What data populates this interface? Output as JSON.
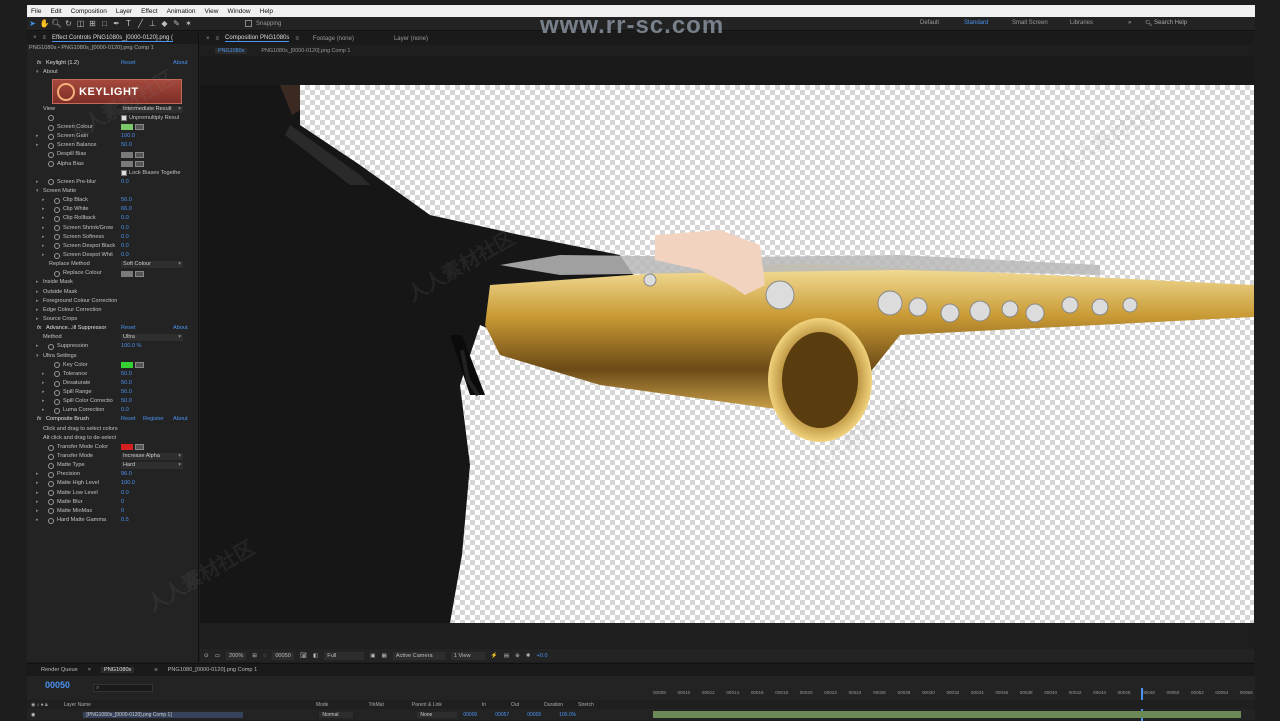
{
  "watermark": "www.rr-sc.com",
  "watermark_cn": "人人素材社区",
  "menu": [
    "File",
    "Edit",
    "Composition",
    "Layer",
    "Effect",
    "Animation",
    "View",
    "Window",
    "Help"
  ],
  "toolbar": {
    "snapping": "Snapping",
    "workspaces": [
      "Default",
      "Standard",
      "Small Screen",
      "Libraries"
    ],
    "active_workspace": "Standard",
    "search_placeholder": "Search Help"
  },
  "effect_controls": {
    "tab_title": "Effect Controls PNG1080s_[0000-0120].png (",
    "breadcrumb": "PNG1080s • PNG1080s_[0000-0120].png Comp 1",
    "logo_text": "KEYLIGHT",
    "rows": [
      {
        "level": 0,
        "fx": true,
        "label": "Keylight (1.2)",
        "link1": "Reset",
        "link2": "About"
      },
      {
        "level": 1,
        "twirl": "open",
        "label": "About"
      },
      {
        "level": 0,
        "label": ""
      },
      {
        "level": 0,
        "label": ""
      },
      {
        "level": 0,
        "label": ""
      },
      {
        "level": 1,
        "label": "View",
        "dropdown": "Intermediate Result"
      },
      {
        "level": 1,
        "sw": true,
        "label": "",
        "checkbox": "Unpremultiply Resul"
      },
      {
        "level": 1,
        "sw": true,
        "label": "Screen Colour",
        "color": "#79c86a",
        "eyed": true
      },
      {
        "level": 1,
        "twirl": "closed",
        "sw": true,
        "label": "Screen Gain",
        "value": "100.0"
      },
      {
        "level": 1,
        "twirl": "closed",
        "sw": true,
        "label": "Screen Balance",
        "value": "50.0"
      },
      {
        "level": 1,
        "sw": true,
        "label": "Despill Bias",
        "color": "#7a7a7a",
        "eyed": true
      },
      {
        "level": 1,
        "sw": true,
        "label": "Alpha Bias",
        "color": "#7a7a7a",
        "eyed": true
      },
      {
        "level": 1,
        "label": "",
        "checkbox": "Lock Biases Togethe"
      },
      {
        "level": 1,
        "twirl": "closed",
        "sw": true,
        "label": "Screen Pre-blur",
        "value": "0.0"
      },
      {
        "level": 1,
        "twirl": "open",
        "label": "Screen Matte"
      },
      {
        "level": 2,
        "twirl": "closed",
        "sw": true,
        "label": "Clip Black",
        "value": "56.0"
      },
      {
        "level": 2,
        "twirl": "closed",
        "sw": true,
        "label": "Clip White",
        "value": "66.0"
      },
      {
        "level": 2,
        "twirl": "closed",
        "sw": true,
        "label": "Clip Rollback",
        "value": "0.0"
      },
      {
        "level": 2,
        "twirl": "closed",
        "sw": true,
        "label": "Screen Shrink/Grow",
        "value": "0.0"
      },
      {
        "level": 2,
        "twirl": "closed",
        "sw": true,
        "label": "Screen Softness",
        "value": "0.0"
      },
      {
        "level": 2,
        "twirl": "closed",
        "sw": true,
        "label": "Screen Despot Black",
        "value": "0.0"
      },
      {
        "level": 2,
        "twirl": "closed",
        "sw": true,
        "label": "Screen Despot Whit",
        "value": "0.0"
      },
      {
        "level": 2,
        "label": "Replace Method",
        "dropdown": "Soft Colour"
      },
      {
        "level": 2,
        "sw": true,
        "label": "Replace Colour",
        "color": "#7a7a7a",
        "eyed": true
      },
      {
        "level": 1,
        "twirl": "closed",
        "label": "Inside Mask"
      },
      {
        "level": 1,
        "twirl": "closed",
        "label": "Outside Mask"
      },
      {
        "level": 1,
        "twirl": "closed",
        "label": "Foreground Colour Correction"
      },
      {
        "level": 1,
        "twirl": "closed",
        "label": "Edge Colour Correction"
      },
      {
        "level": 1,
        "twirl": "closed",
        "label": "Source Crops"
      },
      {
        "level": 0,
        "fx": true,
        "label": "Advance...ill Suppressor",
        "link1": "Reset",
        "link2": "About"
      },
      {
        "level": 1,
        "label": "Method",
        "dropdown": "Ultra"
      },
      {
        "level": 1,
        "twirl": "closed",
        "sw": true,
        "label": "Suppression",
        "value": "100.0 %"
      },
      {
        "level": 1,
        "twirl": "open",
        "label": "Ultra Settings"
      },
      {
        "level": 2,
        "sw": true,
        "label": "Key Color",
        "color": "#35d233",
        "eyed": true
      },
      {
        "level": 2,
        "twirl": "closed",
        "sw": true,
        "label": "Tolerance",
        "value": "50.0"
      },
      {
        "level": 2,
        "twirl": "closed",
        "sw": true,
        "label": "Desaturate",
        "value": "50.0"
      },
      {
        "level": 2,
        "twirl": "closed",
        "sw": true,
        "label": "Spill Range",
        "value": "50.0"
      },
      {
        "level": 2,
        "twirl": "closed",
        "sw": true,
        "label": "Spill Color Correctio",
        "value": "50.0"
      },
      {
        "level": 2,
        "twirl": "closed",
        "sw": true,
        "label": "Luma Correction",
        "value": "0.0"
      },
      {
        "level": 0,
        "fx": true,
        "label": "Composite Brush",
        "link1": "Reset",
        "link0": "Register",
        "link2": "About"
      },
      {
        "level": 1,
        "label": "Click and drag to select colors"
      },
      {
        "level": 1,
        "label": "Alt click and drag to de-select"
      },
      {
        "level": 1,
        "sw": true,
        "label": "Transfer Mode Color",
        "color": "#d42020",
        "eyed": true
      },
      {
        "level": 1,
        "sw": true,
        "label": "Transfer Mode",
        "dropdown": "Increase Alpha"
      },
      {
        "level": 1,
        "sw": true,
        "label": "Matte Type",
        "dropdown": "Hard"
      },
      {
        "level": 1,
        "twirl": "closed",
        "sw": true,
        "label": "Precision",
        "value": "96.0"
      },
      {
        "level": 1,
        "twirl": "closed",
        "sw": true,
        "label": "Matte High Level",
        "value": "100.0"
      },
      {
        "level": 1,
        "twirl": "closed",
        "sw": true,
        "label": "Matte Low Level",
        "value": "0.0"
      },
      {
        "level": 1,
        "twirl": "closed",
        "sw": true,
        "label": "Matte Blur",
        "value": "0"
      },
      {
        "level": 1,
        "twirl": "closed",
        "sw": true,
        "label": "Matte MinMax",
        "value": "0"
      },
      {
        "level": 1,
        "twirl": "closed",
        "sw": true,
        "label": "Hard Matte Gamma",
        "value": "0.5"
      }
    ]
  },
  "composition": {
    "tab_title": "Composition PNG1080s",
    "footage_tab": "Footage (none)",
    "layer_tab": "Layer (none)",
    "crumb1": "PNG1080s",
    "crumb2": "PNG1080s_[0000-0120].png Comp 1",
    "zoom": "200%",
    "timecode": "00050",
    "resolution": "Full",
    "camera": "Active Camera",
    "view": "1 View",
    "offset": "+0.0"
  },
  "timeline": {
    "render_queue": "Render Queue",
    "comp_tab": "PNG1080s",
    "comp_tab2": "PNG1080_[0000-0120].png Comp 1",
    "current_time": "00050",
    "col_layer": "Layer Name",
    "col_mode": "Mode",
    "col_trkmat": "TrkMat",
    "col_parent": "Parent & Link",
    "col_in": "In",
    "col_out": "Out",
    "col_duration": "Duration",
    "col_stretch": "Stretch",
    "layer_name": "[PNG1080s_[0000-0120].png Comp 1]",
    "layer_mode": "Normal",
    "layer_parent": "None",
    "layer_in": "00000",
    "layer_out": "00057",
    "layer_duration": "00058",
    "layer_stretch": "100.0%",
    "ticks": [
      "00008",
      "00010",
      "00012",
      "00014",
      "00016",
      "00018",
      "00020",
      "00022",
      "00024",
      "00026",
      "00028",
      "00030",
      "00032",
      "00034",
      "00036",
      "00038",
      "00040",
      "00042",
      "00044",
      "00046",
      "00048",
      "00050",
      "00052",
      "00054",
      "00056"
    ]
  }
}
